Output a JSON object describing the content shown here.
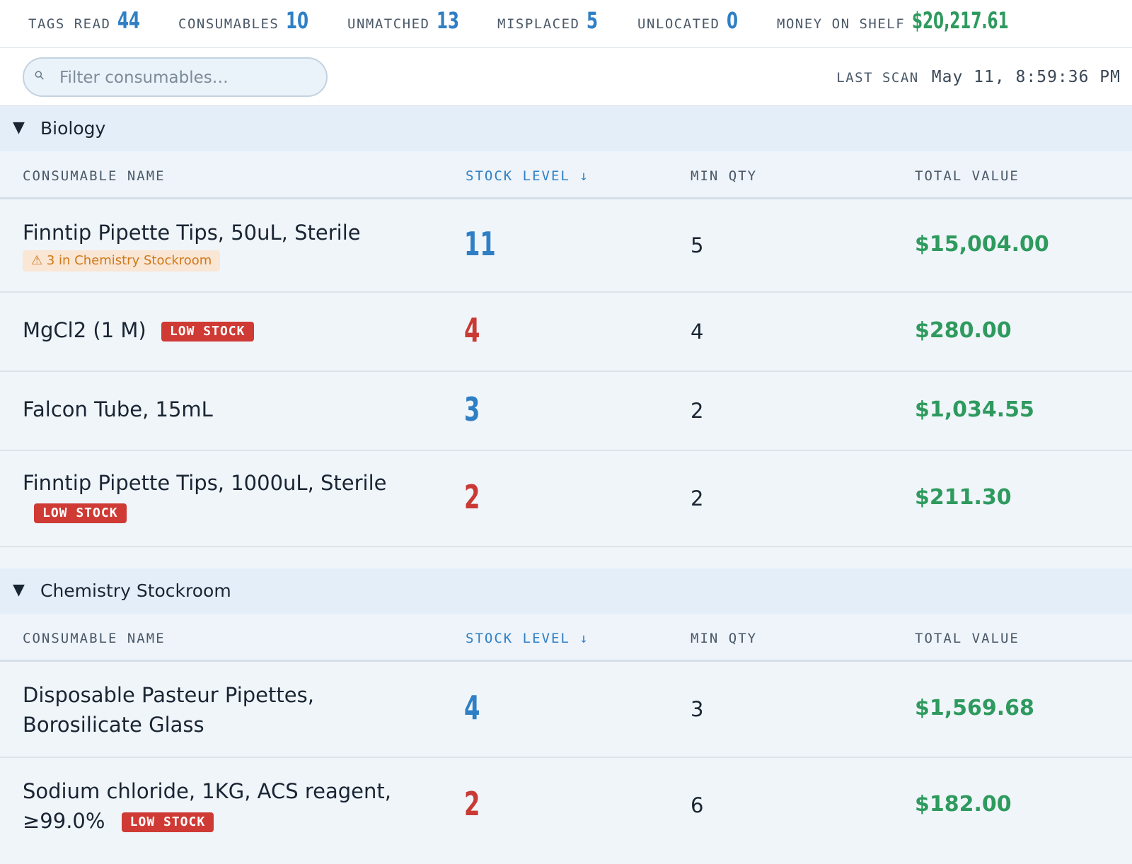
{
  "stats": {
    "tags_read": {
      "label": "TAGS READ",
      "value": "44"
    },
    "consumables": {
      "label": "CONSUMABLES",
      "value": "10"
    },
    "unmatched": {
      "label": "UNMATCHED",
      "value": "13"
    },
    "misplaced": {
      "label": "MISPLACED",
      "value": "5"
    },
    "unlocated": {
      "label": "UNLOCATED",
      "value": "0"
    },
    "money_on_shelf": {
      "label": "MONEY ON SHELF",
      "value": "$20,217.61"
    }
  },
  "filter": {
    "placeholder": "Filter consumables…",
    "icon": "search-icon"
  },
  "last_scan": {
    "label": "LAST SCAN",
    "value": "May 11, 8:59:36 PM"
  },
  "columns": {
    "name": "CONSUMABLE NAME",
    "stock": "STOCK LEVEL ↓",
    "min": "MIN QTY",
    "value": "TOTAL VALUE"
  },
  "colors": {
    "accent": "#2f7fc4",
    "money": "#2e9a5e",
    "low": "#cf3a34",
    "warn": "#d07818"
  },
  "groups": [
    {
      "title": "Biology",
      "caret": "▼",
      "rows": [
        {
          "name": "Finntip Pipette Tips, 50uL, Sterile",
          "warning": "⚠ 3 in Chemistry Stockroom",
          "stock": "11",
          "stock_status": "ok",
          "min": "5",
          "value": "$15,004.00"
        },
        {
          "name": "MgCl2 (1 M)",
          "badge": "LOW STOCK",
          "stock": "4",
          "stock_status": "low",
          "min": "4",
          "value": "$280.00"
        },
        {
          "name": "Falcon Tube, 15mL",
          "stock": "3",
          "stock_status": "ok",
          "min": "2",
          "value": "$1,034.55"
        },
        {
          "name": "Finntip Pipette Tips, 1000uL, Sterile",
          "badge": "LOW STOCK",
          "stock": "2",
          "stock_status": "low",
          "min": "2",
          "value": "$211.30"
        }
      ]
    },
    {
      "title": "Chemistry Stockroom",
      "caret": "▼",
      "rows": [
        {
          "name_line1": "Disposable Pasteur Pipettes,",
          "name_line2": "Borosilicate Glass",
          "stock": "4",
          "stock_status": "ok",
          "min": "3",
          "value": "$1,569.68"
        },
        {
          "name_line1": "Sodium chloride, 1KG, ACS reagent,",
          "name_line2": "≥99.0%",
          "badge": "LOW STOCK",
          "stock": "2",
          "stock_status": "low",
          "min": "6",
          "value": "$182.00"
        }
      ]
    }
  ]
}
